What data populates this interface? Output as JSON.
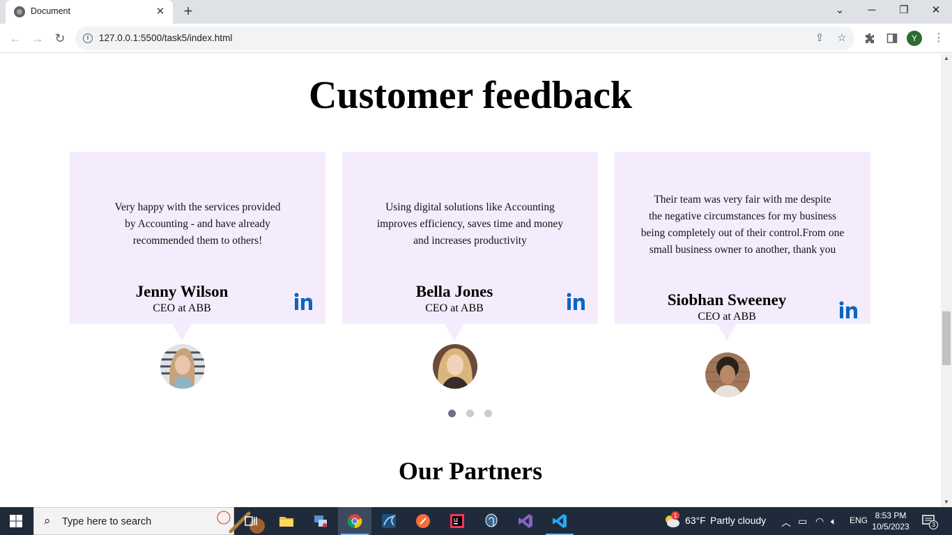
{
  "browser": {
    "tab_title": "Document",
    "tab_close": "✕",
    "new_tab": "+",
    "url": "127.0.0.1:5500/task5/index.html",
    "profile_initial": "Y",
    "controls": {
      "dropdown": "⌄",
      "minimize": "─",
      "restore": "❐",
      "close": "✕"
    }
  },
  "page": {
    "title": "Customer feedback",
    "testimonials": [
      {
        "quote": [
          "Very happy with the services provided",
          "by Accounting - and have already",
          "recommended them to others!"
        ],
        "name": "Jenny Wilson",
        "role": "CEO at ABB"
      },
      {
        "quote": [
          "Using digital solutions like Accounting",
          "improves efficiency, saves time and money",
          "and increases productivity"
        ],
        "name": "Bella Jones",
        "role": "CEO at ABB"
      },
      {
        "quote": [
          "Their team was very fair with me despite",
          "the negative circumstances for my business",
          "being completely out of their control.From one",
          "small business owner to another, thank you"
        ],
        "name": "Siobhan Sweeney",
        "role": "CEO at ABB"
      }
    ],
    "carousel": {
      "dots": 3,
      "active": 0
    },
    "partners_title": "Our Partners"
  },
  "colors": {
    "card_bg": "#f4ecfc",
    "linkedin_blue": "#0a66c2",
    "dot_active": "#6b7187",
    "dot_inactive": "#c9cbd6"
  },
  "taskbar": {
    "search_placeholder": "Type here to search",
    "weather_temp": "63°F",
    "weather_text": "Partly cloudy",
    "weather_badge": "1",
    "language": "ENG",
    "time": "8:53 PM",
    "date": "10/5/2023",
    "notifications": "3",
    "apps": [
      "task-view-icon",
      "file-explorer-icon",
      "network-tool-icon",
      "chrome-icon",
      "wireshark-icon",
      "postman-icon",
      "intellij-icon",
      "postgres-icon",
      "visual-studio-icon",
      "vscode-icon"
    ]
  }
}
